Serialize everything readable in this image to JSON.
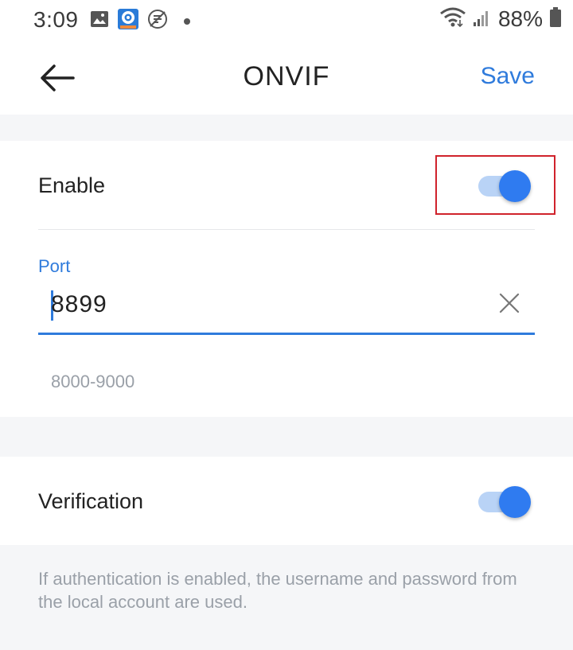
{
  "status_bar": {
    "time": "3:09",
    "battery": "88%",
    "left_icons": [
      "image-icon",
      "camera-app-icon",
      "no-sync-icon",
      "dot-icon"
    ],
    "right_icons": [
      "wifi-icon",
      "signal-icon",
      "battery-icon"
    ]
  },
  "header": {
    "back_icon": "arrow-left-icon",
    "title": "ONVIF",
    "save_label": "Save"
  },
  "enable": {
    "label": "Enable",
    "toggle_on": true
  },
  "port": {
    "label": "Port",
    "value": "8899",
    "hint": "8000-9000",
    "clear_icon": "close-icon"
  },
  "verification": {
    "label": "Verification",
    "toggle_on": true
  },
  "note": "If authentication is enabled, the username and password from the local account are used.",
  "colors": {
    "accent": "#2f7bdc",
    "toggle_knob": "#2f7bf0",
    "toggle_track": "#b9d3f6",
    "highlight": "#d0232c",
    "background_gray": "#f5f6f8",
    "hint_text": "#9aa0a8"
  }
}
